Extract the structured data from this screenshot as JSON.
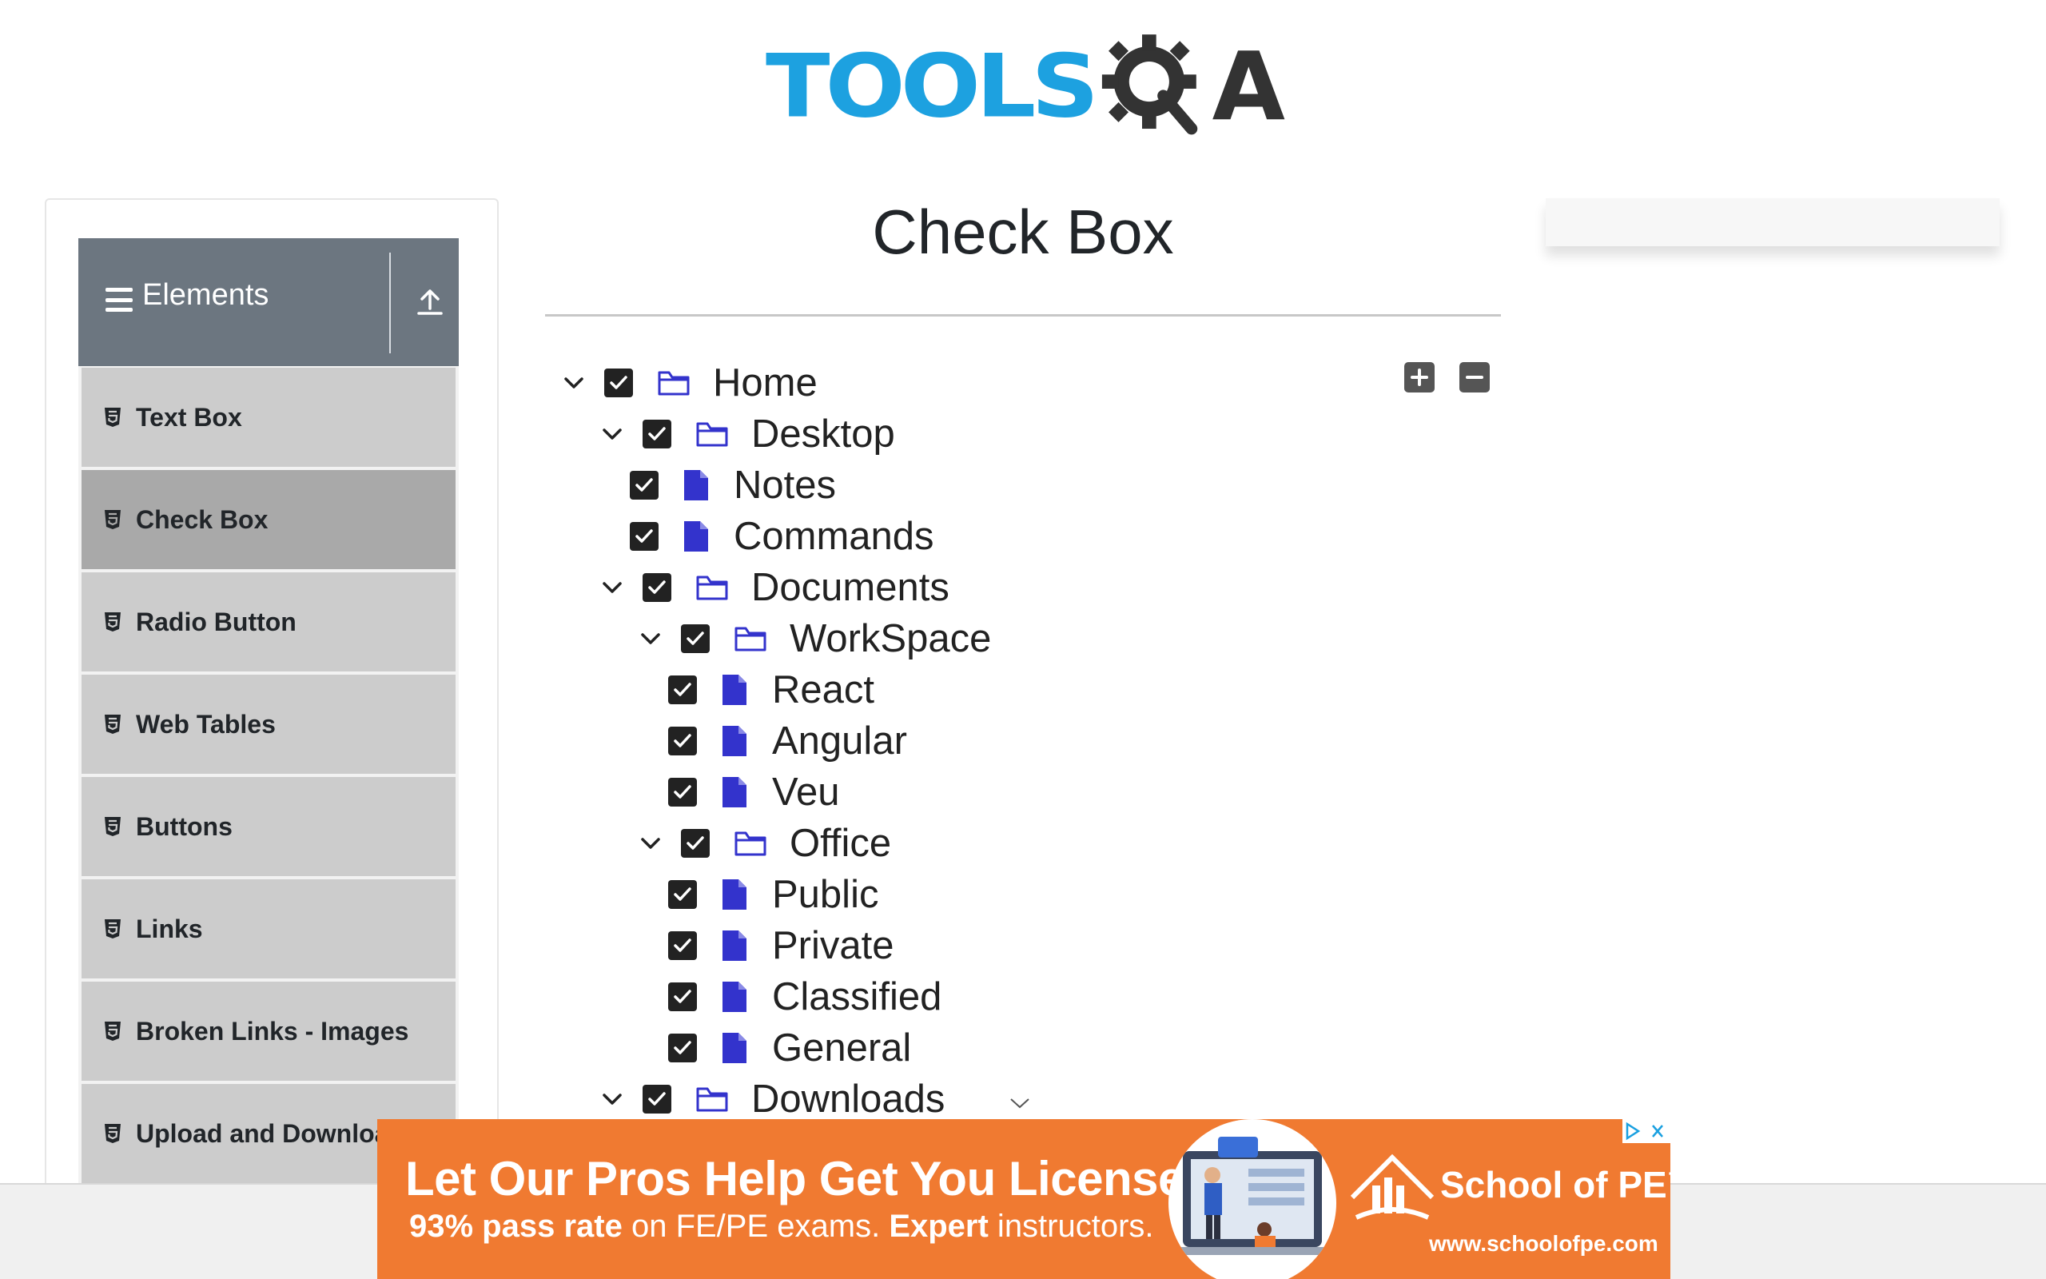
{
  "header": {
    "logo_tools": "TOOLS",
    "logo_a": "A",
    "logo_icon": "gear-magnifier-icon"
  },
  "sidebar": {
    "group_title": "Elements",
    "group_icons": [
      "hamburger-icon",
      "collapse-up-icon"
    ],
    "items": [
      {
        "label": "Text Box",
        "active": false
      },
      {
        "label": "Check Box",
        "active": true
      },
      {
        "label": "Radio Button",
        "active": false
      },
      {
        "label": "Web Tables",
        "active": false
      },
      {
        "label": "Buttons",
        "active": false
      },
      {
        "label": "Links",
        "active": false
      },
      {
        "label": "Broken Links - Images",
        "active": false
      },
      {
        "label": "Upload and Download",
        "active": false
      }
    ]
  },
  "main": {
    "title": "Check Box",
    "controls": {
      "expand_all": "plus-square-icon",
      "collapse_all": "minus-square-icon"
    },
    "tree": [
      {
        "label": "Home",
        "type": "folder",
        "checked": true,
        "expanded": true
      },
      {
        "label": "Desktop",
        "type": "folder",
        "checked": true,
        "expanded": true
      },
      {
        "label": "Notes",
        "type": "file",
        "checked": true
      },
      {
        "label": "Commands",
        "type": "file",
        "checked": true
      },
      {
        "label": "Documents",
        "type": "folder",
        "checked": true,
        "expanded": true
      },
      {
        "label": "WorkSpace",
        "type": "folder",
        "checked": true,
        "expanded": true
      },
      {
        "label": "React",
        "type": "file",
        "checked": true
      },
      {
        "label": "Angular",
        "type": "file",
        "checked": true
      },
      {
        "label": "Veu",
        "type": "file",
        "checked": true
      },
      {
        "label": "Office",
        "type": "folder",
        "checked": true,
        "expanded": true
      },
      {
        "label": "Public",
        "type": "file",
        "checked": true
      },
      {
        "label": "Private",
        "type": "file",
        "checked": true
      },
      {
        "label": "Classified",
        "type": "file",
        "checked": true
      },
      {
        "label": "General",
        "type": "file",
        "checked": true
      },
      {
        "label": "Downloads",
        "type": "folder",
        "checked": true,
        "expanded": true
      }
    ]
  },
  "ad": {
    "headline": "Let Our Pros Help Get You Licensed",
    "sub_bold_1": "93% pass rate",
    "sub_text_1": " on FE/PE exams. ",
    "sub_bold_2": "Expert",
    "sub_text_2": " instructors.",
    "brand": "School of PE™",
    "url": "www.schoolofpe.com",
    "choices_icon": "adchoices-close-icon"
  },
  "colors": {
    "brand_blue": "#1da1e0",
    "sidebar_header": "#6c7680",
    "menu_item": "#cccccc",
    "menu_item_active": "#a9a9a9",
    "file_icon": "#3333cc",
    "ad_orange": "#f07a31"
  }
}
